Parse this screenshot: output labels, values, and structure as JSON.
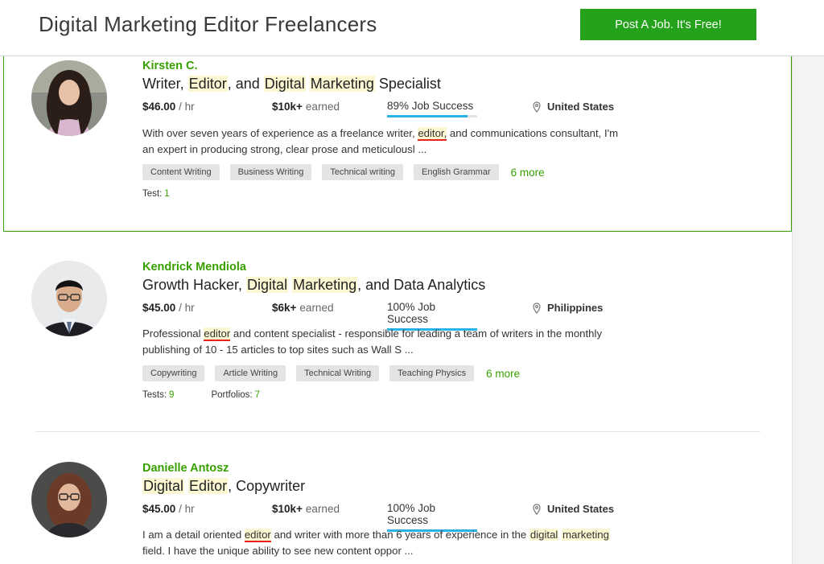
{
  "header": {
    "title": "Digital Marketing Editor Freelancers",
    "post_job_label": "Post A Job. It's Free!"
  },
  "freelancers": [
    {
      "name": "Kirsten C.",
      "headline": {
        "p1": "Writer, ",
        "h1": "Editor",
        "p2": ", and ",
        "h2": "Digital",
        "p3": " ",
        "h3": "Marketing",
        "p4": " Specialist"
      },
      "rate": "$46.00",
      "rate_unit": "/ hr",
      "earned_amount": "$10k+",
      "earned_label": "earned",
      "job_success_label": "89% Job Success",
      "job_success_pct": 89,
      "location": "United States",
      "description": {
        "t1": "With over seven years of experience as a freelance writer, ",
        "t2": "editor,",
        "t3": " and communications consultant, I'm an expert in producing strong, clear prose and meticulousl ..."
      },
      "skills": [
        "Content Writing",
        "Business Writing",
        "Technical writing",
        "English Grammar"
      ],
      "more_label": "6 more",
      "tests_label": "Test:",
      "tests_count": "1"
    },
    {
      "name": "Kendrick Mendiola",
      "headline": {
        "p1": "Growth Hacker, ",
        "h1": "Digital",
        "p2": " ",
        "h2": "Marketing",
        "p3": ", and Data Analytics"
      },
      "rate": "$45.00",
      "rate_unit": "/ hr",
      "earned_amount": "$6k+",
      "earned_label": "earned",
      "job_success_label": "100% Job Success",
      "job_success_pct": 100,
      "location": "Philippines",
      "description": {
        "t1": "Professional ",
        "t2": "editor",
        "t3": " and content specialist - responsible for leading a team of writers in the monthly publishing of 10 - 15 articles to top sites such as Wall S ..."
      },
      "skills": [
        "Copywriting",
        "Article Writing",
        "Technical Writing",
        "Teaching Physics"
      ],
      "more_label": "6 more",
      "tests_label": "Tests:",
      "tests_count": "9",
      "portfolios_label": "Portfolios:",
      "portfolios_count": "7"
    },
    {
      "name": "Danielle Antosz",
      "headline": {
        "h1": "Digital",
        "p1": " ",
        "h2": "Editor",
        "p2": ", Copywriter"
      },
      "rate": "$45.00",
      "rate_unit": "/ hr",
      "earned_amount": "$10k+",
      "earned_label": "earned",
      "job_success_label": "100% Job Success",
      "job_success_pct": 100,
      "location": "United States",
      "description": {
        "t1": "I am a detail oriented ",
        "t2": "editor",
        "t3": " and writer with more than 6 years of experience in the ",
        "t4": "digital",
        "t5": " ",
        "t6": "marketing",
        "t7": " field. I have the unique ability to see new content oppor ..."
      }
    }
  ],
  "colors": {
    "green": "#37a000",
    "button": "#24a21b",
    "success_bar": "#29b2e6",
    "highlight": "#fbf7d2",
    "underline": "#e8231c"
  }
}
